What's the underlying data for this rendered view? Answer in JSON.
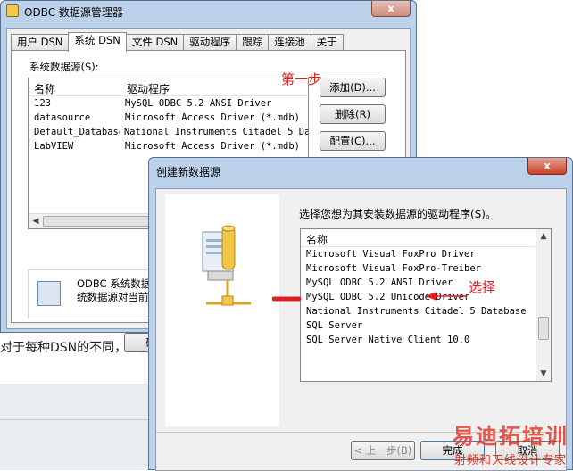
{
  "background": {
    "text": "对于每种DSN的不同，下面"
  },
  "odbc_window": {
    "title": "ODBC 数据源管理器",
    "close_label": "x",
    "tabs": [
      {
        "label": "用户 DSN",
        "active": false
      },
      {
        "label": "系统 DSN",
        "active": true
      },
      {
        "label": "文件 DSN",
        "active": false
      },
      {
        "label": "驱动程序",
        "active": false
      },
      {
        "label": "跟踪",
        "active": false
      },
      {
        "label": "连接池",
        "active": false
      },
      {
        "label": "关于",
        "active": false
      }
    ],
    "system_dsn_label": "系统数据源(S):",
    "columns": [
      "名称",
      "驱动程序"
    ],
    "rows": [
      {
        "name": "123",
        "driver": "MySQL ODBC 5.2 ANSI Driver"
      },
      {
        "name": "datasource",
        "driver": "Microsoft Access Driver (*.mdb)"
      },
      {
        "name": "Default_Database",
        "driver": "National Instruments Citadel 5 Da"
      },
      {
        "name": "LabVIEW",
        "driver": "Microsoft Access Driver (*.mdb)"
      }
    ],
    "buttons": {
      "add": "添加(D)...",
      "remove": "删除(R)",
      "configure": "配置(C)...",
      "ok_partial": "确"
    },
    "annotation_step1": "第一步",
    "info_text_line1": "ODBC 系统数据源",
    "info_text_line2": "统数据源对当前"
  },
  "create_dialog": {
    "title": "创建新数据源",
    "close_label": "x",
    "prompt": "选择您想为其安装数据源的驱动程序(S)。",
    "column": "名称",
    "drivers": [
      "Microsoft Visual FoxPro Driver",
      "Microsoft Visual FoxPro-Treiber",
      "MySQL ODBC 5.2 ANSI Driver",
      "MySQL ODBC 5.2 Unicode Driver",
      "National Instruments Citadel 5 Database",
      "SQL Server",
      "SQL Server Native Client 10.0"
    ],
    "annotation_select": "选择",
    "buttons": {
      "back": "< 上一步(B)",
      "finish": "完成",
      "cancel": "取消"
    },
    "watermark_line1": "易迪拓培训",
    "watermark_line2": "射频和天线设计专家"
  },
  "colors": {
    "annotation_red": "#e02020",
    "window_frame": "#bcd1ea"
  }
}
